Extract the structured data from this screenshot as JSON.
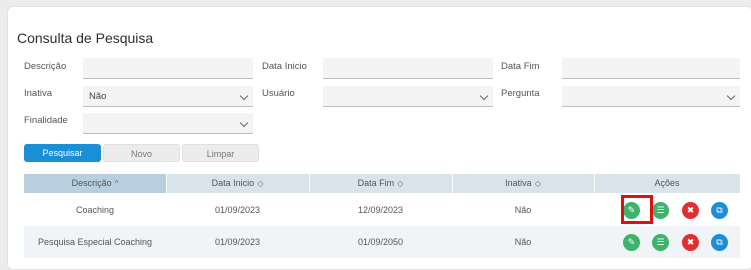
{
  "page": {
    "title": "Consulta de Pesquisa"
  },
  "filters": {
    "descricao_label": "Descrição",
    "descricao_value": "",
    "data_inicio_label": "Data Inicio",
    "data_inicio_value": "",
    "data_fim_label": "Data Fim",
    "data_fim_value": "",
    "inativa_label": "Inativa",
    "inativa_value": "Não",
    "usuario_label": "Usuário",
    "usuario_value": "",
    "pergunta_label": "Pergunta",
    "pergunta_value": "",
    "finalidade_label": "Finalidade",
    "finalidade_value": ""
  },
  "buttons": {
    "pesquisar": "Pesquisar",
    "novo": "Novo",
    "limpar": "Limpar"
  },
  "table": {
    "headers": [
      "Descrição",
      "Data Inicio",
      "Data Fim",
      "Inativa",
      "Ações"
    ],
    "sort_icons": {
      "descricao": "^",
      "data_inicio": "◇",
      "data_fim": "◇",
      "inativa": "◇"
    },
    "rows": [
      {
        "descricao": "Coaching",
        "data_inicio": "01/09/2023",
        "data_fim": "12/09/2023",
        "inativa": "Não"
      },
      {
        "descricao": "Pesquisa Especial Coaching",
        "data_inicio": "01/09/2023",
        "data_fim": "01/09/2050",
        "inativa": "Não"
      }
    ],
    "action_icons": [
      "edit-icon",
      "list-icon",
      "delete-icon",
      "copy-icon"
    ]
  },
  "colors": {
    "primary": "#1a8fd6",
    "success": "#3db36b",
    "danger": "#e02f2f",
    "highlight": "#e01010",
    "header_bg": "#d9e3ea"
  }
}
